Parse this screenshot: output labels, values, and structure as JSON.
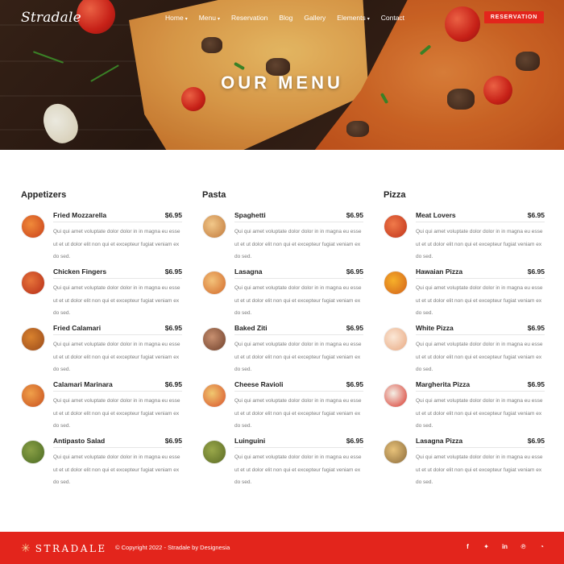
{
  "brand": {
    "logo": "Stradale",
    "footer_logo": "STRADALE"
  },
  "nav": {
    "items": [
      {
        "label": "Home",
        "has_caret": true
      },
      {
        "label": "Menu",
        "has_caret": true
      },
      {
        "label": "Reservation",
        "has_caret": false
      },
      {
        "label": "Blog",
        "has_caret": false
      },
      {
        "label": "Gallery",
        "has_caret": false
      },
      {
        "label": "Elements",
        "has_caret": true
      },
      {
        "label": "Contact",
        "has_caret": false
      }
    ],
    "cta": "RESERVATION"
  },
  "hero": {
    "title": "OUR MENU"
  },
  "description": "Qui qui amet voluptate dolor dolor in in magna eu esse ut et ut dolor elit non qui et excepteur fugiat veniam ex do sed.",
  "columns": [
    {
      "heading": "Appetizers",
      "items": [
        {
          "name": "Fried Mozzarella",
          "price": "$6.95"
        },
        {
          "name": "Chicken Fingers",
          "price": "$6.95"
        },
        {
          "name": "Fried Calamari",
          "price": "$6.95"
        },
        {
          "name": "Calamari Marinara",
          "price": "$6.95"
        },
        {
          "name": "Antipasto Salad",
          "price": "$6.95"
        }
      ]
    },
    {
      "heading": "Pasta",
      "items": [
        {
          "name": "Spaghetti",
          "price": "$6.95"
        },
        {
          "name": "Lasagna",
          "price": "$6.95"
        },
        {
          "name": "Baked Ziti",
          "price": "$6.95"
        },
        {
          "name": "Cheese Ravioli",
          "price": "$6.95"
        },
        {
          "name": "Luinguini",
          "price": "$6.95"
        }
      ]
    },
    {
      "heading": "Pizza",
      "items": [
        {
          "name": "Meat Lovers",
          "price": "$6.95"
        },
        {
          "name": "Hawaian Pizza",
          "price": "$6.95"
        },
        {
          "name": "White Pizza",
          "price": "$6.95"
        },
        {
          "name": "Margherita Pizza",
          "price": "$6.95"
        },
        {
          "name": "Lasagna Pizza",
          "price": "$6.95"
        }
      ]
    }
  ],
  "footer": {
    "copyright": "© Copyright 2022 - Stradale by Designesia",
    "socials": [
      "facebook-icon",
      "twitter-icon",
      "linkedin-icon",
      "pinterest-icon",
      "rss-icon"
    ]
  },
  "colors": {
    "accent": "#e3251c",
    "heading": "#222222",
    "text_muted": "#7a7a7a"
  }
}
